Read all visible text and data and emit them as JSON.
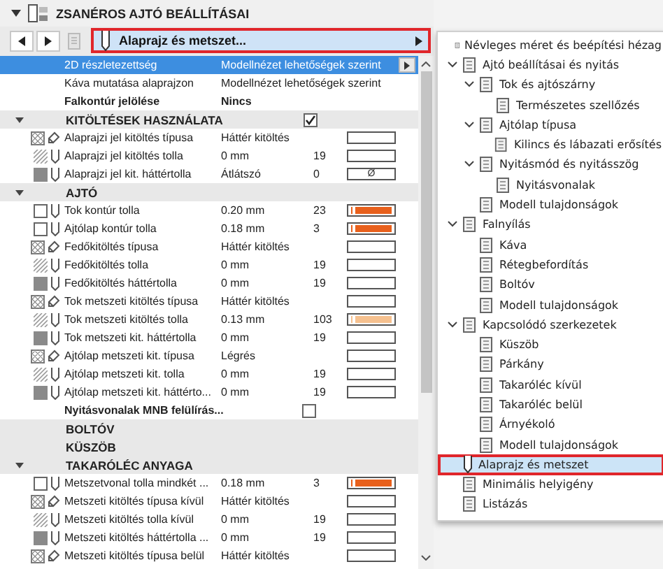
{
  "panel": {
    "title": "ZSANÉROS AJTÓ BEÁLLÍTÁSAI",
    "expanded": true
  },
  "toolbar": {
    "page_select": "Alaprajz és metszet..."
  },
  "rows": [
    {
      "kind": "plain",
      "label": "2D részletezettség",
      "value": "Modellnézet lehetőségek szerint",
      "selected": true,
      "bold": false
    },
    {
      "kind": "plain",
      "label": "Káva mutatása alaprajzon",
      "value": "Modellnézet lehetőségek szerint",
      "selected": false,
      "bold": false
    },
    {
      "kind": "plain",
      "label": "Falkontúr jelölése",
      "value": "Nincs",
      "selected": false,
      "bold": true
    },
    {
      "kind": "section",
      "label": "KITÖLTÉSEK HASZNÁLATA",
      "collapsible": true,
      "checked": true
    },
    {
      "kind": "fill_type",
      "label": "Alaprajzi jel kitöltés típusa",
      "value": "Háttér kitöltés"
    },
    {
      "kind": "fill_pen",
      "label": "Alaprajzi jel kitöltés tolla",
      "value": "0 mm",
      "number": "19"
    },
    {
      "kind": "fill_bg",
      "label": "Alaprajzi jel kit. háttértolla",
      "value": "Átlátszó",
      "number": "0",
      "swatch_text": "Ø"
    },
    {
      "kind": "section",
      "label": "AJTÓ",
      "collapsible": true
    },
    {
      "kind": "contour_pen",
      "label": "Tok kontúr tolla",
      "value": "0.20 mm",
      "number": "23",
      "color": "#e8601c"
    },
    {
      "kind": "contour_pen",
      "label": "Ajtólap kontúr tolla",
      "value": "0.18 mm",
      "number": "3",
      "color": "#e8601c"
    },
    {
      "kind": "fill_type",
      "label": "Fedőkitöltés típusa",
      "value": "Háttér kitöltés"
    },
    {
      "kind": "fill_pen",
      "label": "Fedőkitöltés tolla",
      "value": "0 mm",
      "number": "19"
    },
    {
      "kind": "fill_bg",
      "label": "Fedőkitöltés háttértolla",
      "value": "0 mm",
      "number": "19"
    },
    {
      "kind": "fill_type",
      "label": "Tok metszeti kitöltés típusa",
      "value": "Háttér kitöltés"
    },
    {
      "kind": "fill_pen",
      "label": "Tok metszeti kitöltés tolla",
      "value": "0.13 mm",
      "number": "103",
      "color": "#f6c18f"
    },
    {
      "kind": "fill_bg",
      "label": "Tok metszeti kit. háttértolla",
      "value": "0 mm",
      "number": "19"
    },
    {
      "kind": "fill_type",
      "label": "Ajtólap metszeti kit. típusa",
      "value": "Légrés"
    },
    {
      "kind": "fill_pen",
      "label": "Ajtólap metszeti kit. tolla",
      "value": "0 mm",
      "number": "19"
    },
    {
      "kind": "fill_bg",
      "label": "Ajtólap metszeti kit. háttérto...",
      "value": "0 mm",
      "number": "19"
    },
    {
      "kind": "check",
      "label": "Nyitásvonalak MNB felülírás...",
      "checked": false
    },
    {
      "kind": "section",
      "label": "BOLTÓV",
      "collapsible": false
    },
    {
      "kind": "section",
      "label": "KÜSZÖB",
      "collapsible": false
    },
    {
      "kind": "section",
      "label": "TAKARÓLÉC ANYAGA",
      "collapsible": true
    },
    {
      "kind": "contour_pen",
      "label": "Metszetvonal tolla mindkét ...",
      "value": "0.18 mm",
      "number": "3",
      "color": "#e8601c"
    },
    {
      "kind": "fill_type",
      "label": "Metszeti kitöltés típusa kívül",
      "value": "Háttér kitöltés"
    },
    {
      "kind": "fill_pen",
      "label": "Metszeti kitöltés tolla kívül",
      "value": "0 mm",
      "number": "19"
    },
    {
      "kind": "fill_bg",
      "label": "Metszeti kitöltés háttértolla ...",
      "value": "0 mm",
      "number": "19"
    },
    {
      "kind": "fill_type",
      "label": "Metszeti kitöltés típusa belül",
      "value": "Háttér kitöltés"
    }
  ],
  "menu": {
    "items": [
      {
        "label": "Névleges méret és beépítési hézag",
        "selected": false
      },
      {
        "label": "Ajtó beállításai és nyitás",
        "selected": false,
        "expanded": true,
        "children": [
          {
            "label": "Tok és ajtószárny",
            "selected": false,
            "expanded": true,
            "children": [
              {
                "label": "Természetes szellőzés",
                "selected": false
              }
            ]
          },
          {
            "label": "Ajtólap típusa",
            "selected": false,
            "expanded": true,
            "children": [
              {
                "label": "Kilincs és lábazati erősítés",
                "selected": false
              }
            ]
          },
          {
            "label": "Nyitásmód és nyitásszög",
            "selected": false,
            "expanded": true,
            "children": [
              {
                "label": "Nyitásvonalak",
                "selected": false
              }
            ]
          },
          {
            "label": "Modell tulajdonságok",
            "selected": false
          }
        ]
      },
      {
        "label": "Falnyílás",
        "selected": false,
        "expanded": true,
        "children": [
          {
            "label": "Káva",
            "selected": false
          },
          {
            "label": "Rétegbefordítás",
            "selected": false
          },
          {
            "label": "Boltóv",
            "selected": false
          },
          {
            "label": "Modell tulajdonságok",
            "selected": false
          }
        ]
      },
      {
        "label": "Kapcsolódó szerkezetek",
        "selected": false,
        "expanded": true,
        "children": [
          {
            "label": "Küszöb",
            "selected": false
          },
          {
            "label": "Párkány",
            "selected": false
          },
          {
            "label": "Takaróléc kívül",
            "selected": false
          },
          {
            "label": "Takaróléc belül",
            "selected": false
          },
          {
            "label": "Árnyékoló",
            "selected": false
          },
          {
            "label": "Modell tulajdonságok",
            "selected": false
          }
        ]
      },
      {
        "label": "Alaprajz és metszet",
        "selected": true
      },
      {
        "label": "Minimális helyigény",
        "selected": false
      },
      {
        "label": "Listázás",
        "selected": false
      }
    ]
  }
}
